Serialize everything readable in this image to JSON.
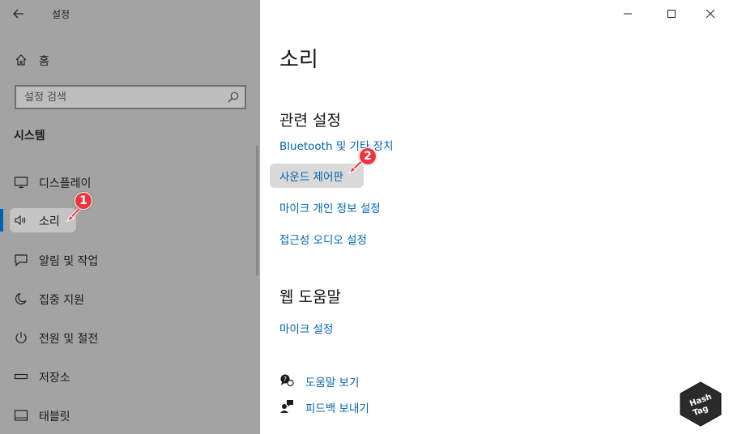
{
  "window": {
    "app_title": "설정",
    "controls": {
      "minimize": "—",
      "maximize": "☐",
      "close": "✕"
    }
  },
  "sidebar": {
    "home_label": "홈",
    "search_placeholder": "설정 검색",
    "section_title": "시스템",
    "items": [
      {
        "label": "디스플레이",
        "icon": "monitor-icon"
      },
      {
        "label": "소리",
        "icon": "speaker-icon",
        "active": true
      },
      {
        "label": "알림 및 작업",
        "icon": "notification-icon"
      },
      {
        "label": "집중 지원",
        "icon": "moon-icon"
      },
      {
        "label": "전원 및 절전",
        "icon": "power-icon"
      },
      {
        "label": "저장소",
        "icon": "storage-icon"
      },
      {
        "label": "태블릿",
        "icon": "tablet-icon"
      }
    ]
  },
  "main": {
    "page_title": "소리",
    "related_heading": "관련 설정",
    "related_links": [
      "Bluetooth 및 기타 장치",
      "사운드 제어판",
      "마이크 개인 정보 설정",
      "접근성 오디오 설정"
    ],
    "web_help_heading": "웹 도움말",
    "web_help_links": [
      "마이크 설정"
    ],
    "help_link": "도움말 보기",
    "feedback_link": "피드백 보내기"
  },
  "annotations": {
    "marker_1": "1",
    "marker_2": "2"
  },
  "logo": {
    "line1": "Hash",
    "line2": "Tag"
  },
  "colors": {
    "accent": "#0063b1",
    "marker": "#e8373e",
    "sidebar_bg": "#a3a3a3"
  }
}
